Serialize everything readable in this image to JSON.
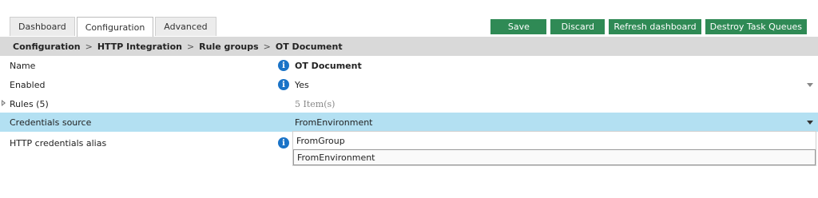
{
  "tabs": [
    {
      "label": "Dashboard"
    },
    {
      "label": "Configuration"
    },
    {
      "label": "Advanced"
    }
  ],
  "actions": {
    "save": "Save",
    "discard": "Discard",
    "refresh": "Refresh dashboard",
    "destroy": "Destroy Task Queues"
  },
  "breadcrumb": [
    "Configuration",
    "HTTP Integration",
    "Rule groups",
    "OT Document"
  ],
  "breadcrumb_separator": ">",
  "rows": [
    {
      "label": "Name",
      "value": "OT Document"
    },
    {
      "label": "Enabled",
      "value": "Yes"
    },
    {
      "label": "Rules (5)",
      "value": "5 Item(s)"
    },
    {
      "label": "Credentials source",
      "value": "FromEnvironment"
    },
    {
      "label": "HTTP credentials alias",
      "value": ""
    }
  ],
  "dropdown": {
    "options": [
      "FromGroup",
      "FromEnvironment"
    ]
  },
  "info_glyph": "i",
  "colors": {
    "button_green": "#2f8a55",
    "selected_row": "#b3e0f2",
    "breadcrumb_bg": "#d9d9d9",
    "info_blue": "#1a73c7"
  }
}
